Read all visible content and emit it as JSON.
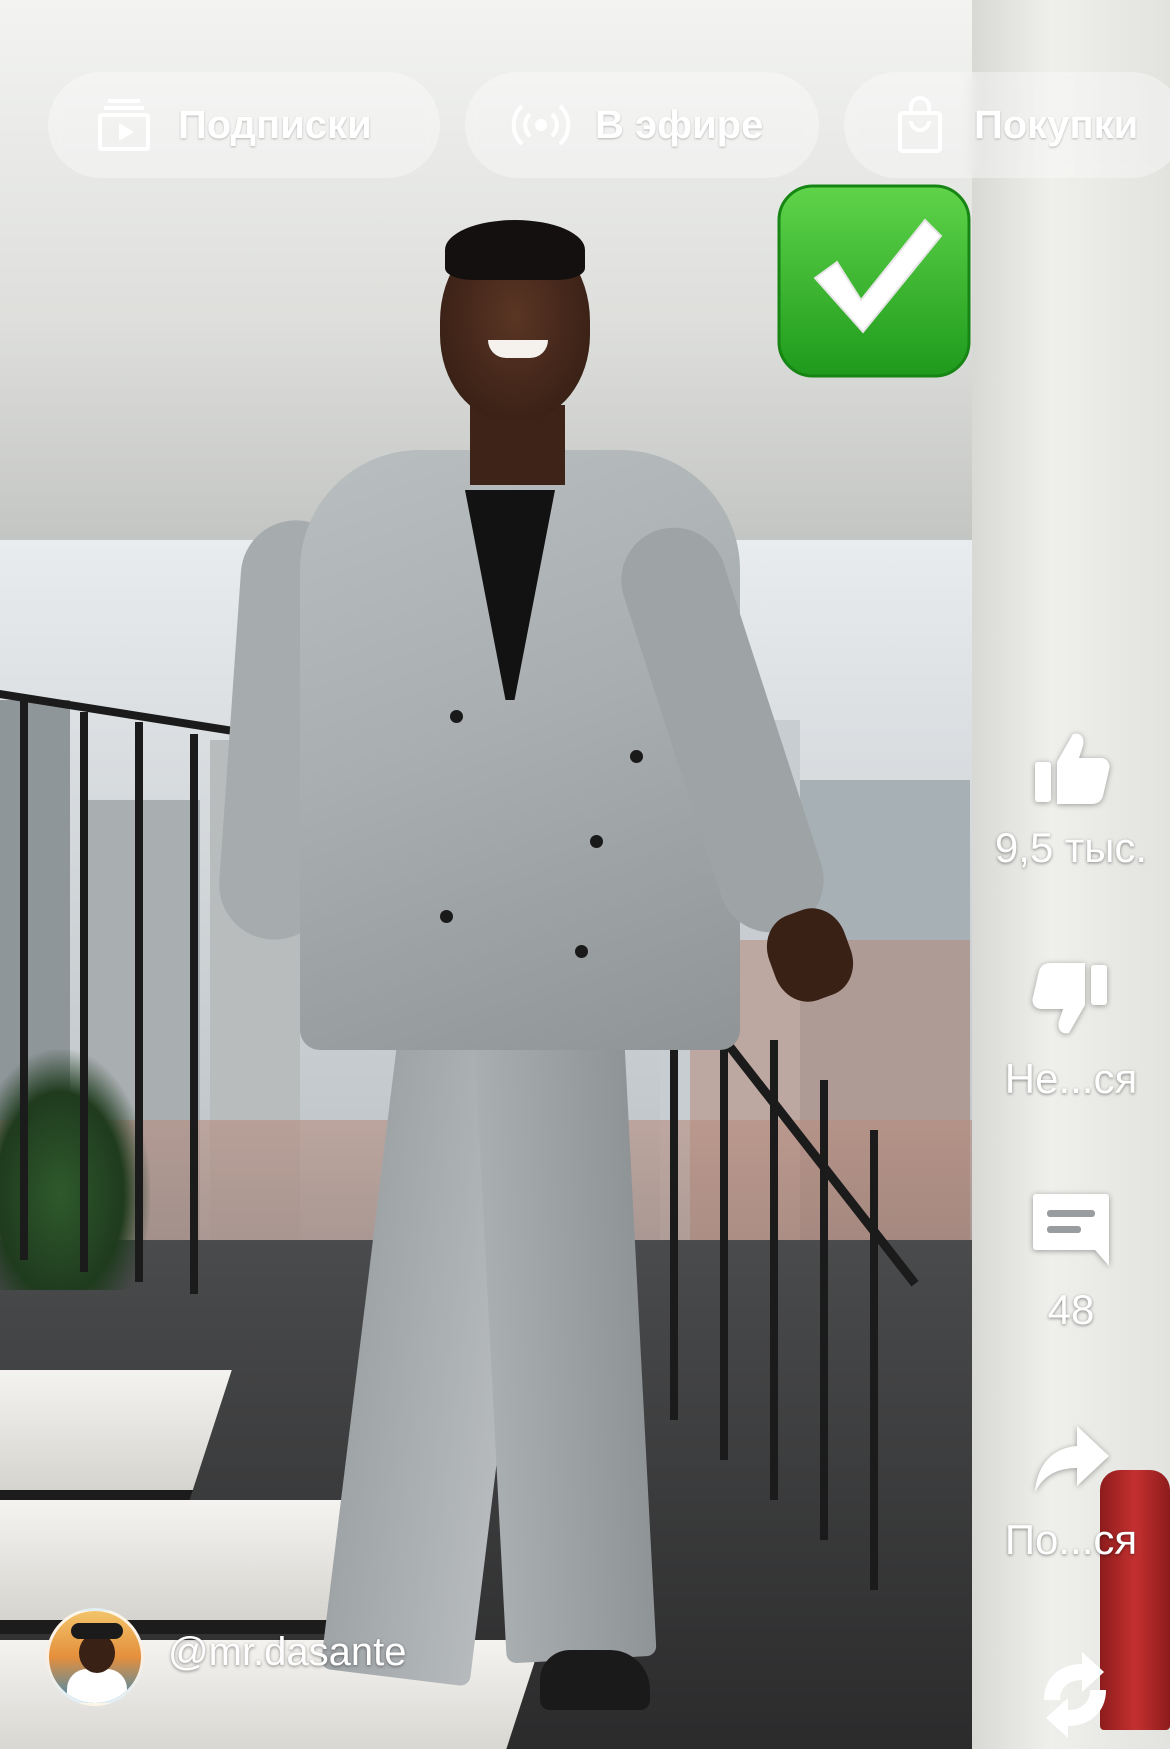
{
  "top_tabs": [
    {
      "label": "Подписки",
      "icon": "subscriptions-icon"
    },
    {
      "label": "В эфире",
      "icon": "live-broadcast-icon"
    },
    {
      "label": "Покупки",
      "icon": "shopping-bag-icon"
    }
  ],
  "sticker": {
    "icon": "green-check-mark-icon",
    "color": "#2fb52a"
  },
  "actions": {
    "like": {
      "label": "9,5 тыс.",
      "icon": "thumbs-up-icon"
    },
    "dislike": {
      "label": "Не...ся",
      "icon": "thumbs-down-icon"
    },
    "comment": {
      "label": "48",
      "icon": "comment-icon"
    },
    "share": {
      "label": "По...ся",
      "icon": "share-arrow-icon"
    },
    "remix": {
      "icon": "remix-icon"
    }
  },
  "channel": {
    "handle": "@mr.dasante",
    "avatar": "channel-avatar"
  },
  "colors": {
    "overlay_text": "#ffffff",
    "pill_bg": "rgba(255,255,255,0.35)"
  }
}
